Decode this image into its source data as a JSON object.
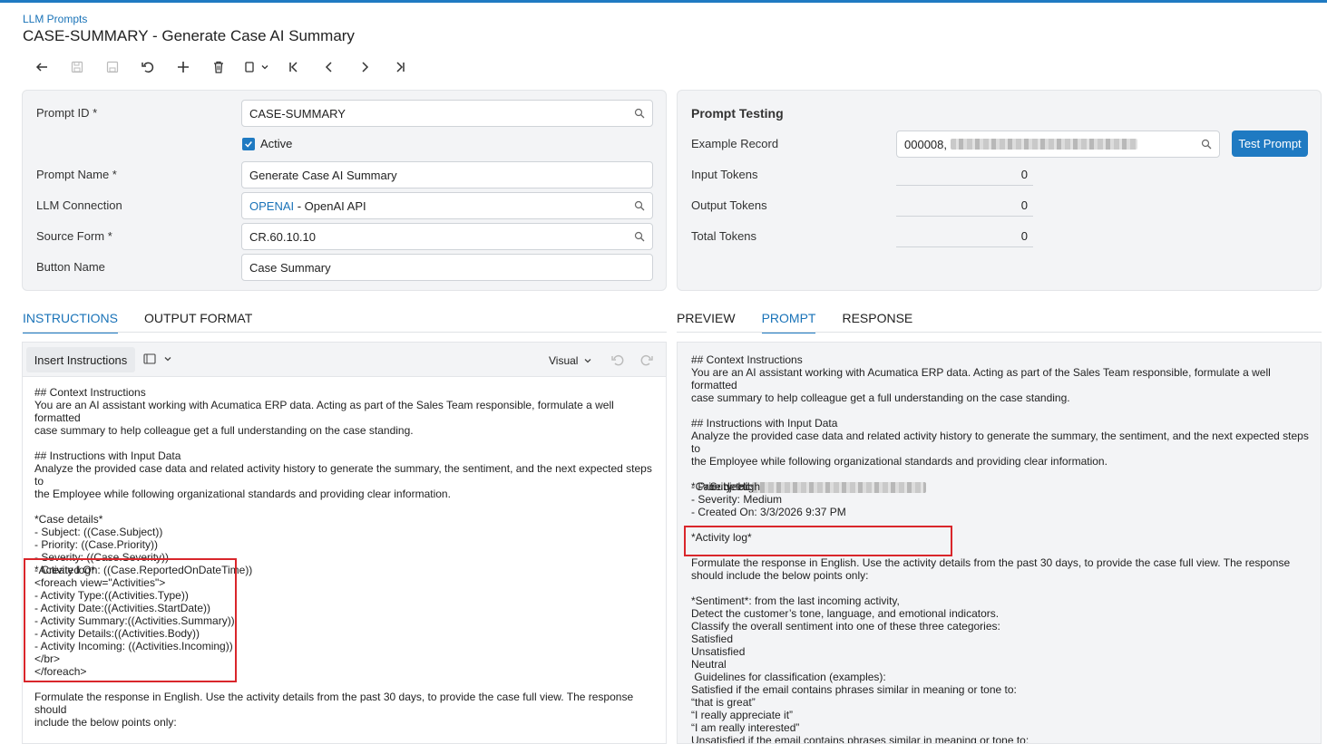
{
  "breadcrumb": "LLM Prompts",
  "title": "CASE-SUMMARY - Generate Case AI Summary",
  "toolbar": {
    "icons": [
      "back-icon",
      "save-close-icon",
      "save-icon",
      "undo-icon",
      "add-icon",
      "delete-icon",
      "copy-paste-icon",
      "first-icon",
      "previous-icon",
      "next-icon",
      "last-icon"
    ]
  },
  "form": {
    "prompt_id_label": "Prompt ID *",
    "prompt_id_value": "CASE-SUMMARY",
    "active_label": "Active",
    "active_checked": true,
    "prompt_name_label": "Prompt Name *",
    "prompt_name_value": "Generate Case AI Summary",
    "llm_connection_label": "LLM Connection",
    "llm_connection_link": "OPENAI",
    "llm_connection_rest": " - OpenAI API",
    "source_form_label": "Source Form *",
    "source_form_value": "CR.60.10.10",
    "button_name_label": "Button Name",
    "button_name_value": "Case Summary"
  },
  "testing": {
    "title": "Prompt Testing",
    "example_record_label": "Example Record",
    "example_record_value": "000008,",
    "test_button": "Test Prompt",
    "input_tokens_label": "Input Tokens",
    "input_tokens_value": "0",
    "output_tokens_label": "Output Tokens",
    "output_tokens_value": "0",
    "total_tokens_label": "Total Tokens",
    "total_tokens_value": "0"
  },
  "left_tabs": [
    "INSTRUCTIONS",
    "OUTPUT FORMAT"
  ],
  "right_tabs": [
    "PREVIEW",
    "PROMPT",
    "RESPONSE"
  ],
  "editor": {
    "insert_button": "Insert Instructions",
    "mode": "Visual",
    "text_part1": "## Context Instructions\nYou are an AI assistant working with Acumatica ERP data. Acting as part of the Sales Team responsible, formulate a well formatted\ncase summary to help colleague get a full understanding on the case standing.\n\n## Instructions with Input Data\nAnalyze the provided case data and related activity history to generate the summary, the sentiment, and the next expected steps to\nthe Employee while following organizational standards and providing clear information.\n\n*Case details*\n- Subject: ((Case.Subject))\n- Priority: ((Case.Priority))\n- Severity: ((Case.Severity))\n- Created On: ((Case.ReportedOnDateTime))",
    "text_part2": "*Activity log*\n<foreach view=\"Activities\">\n- Activity Type:((Activities.Type))\n- Activity Date:((Activities.StartDate))\n- Activity Summary:((Activities.Summary))\n- Activity Details:((Activities.Body))\n- Activity Incoming: ((Activities.Incoming))\n</br>\n</foreach>",
    "text_part3": "Formulate the response in English. Use the activity details from the past 30 days, to provide the case full view. The response should\ninclude the below points only:\n\n*Sentiment*: from the last incoming activity,"
  },
  "prompt_view": {
    "text_part1": "## Context Instructions\nYou are an AI assistant working with Acumatica ERP data. Acting as part of the Sales Team responsible, formulate a well formatted\ncase summary to help colleague get a full understanding on the case standing.\n\n## Instructions with Input Data\nAnalyze the provided case data and related activity history to generate the summary, the sentiment, and the next expected steps to\nthe Employee while following organizational standards and providing clear information.\n\n*Case details*",
    "subject_prefix": "- Subject: ",
    "text_part2": "- Priority: High\n- Severity: Medium\n- Created On: 3/3/2026 9:37 PM\n\n*Activity log*\n\nFormulate the response in English. Use the activity details from the past 30 days, to provide the case full view. The response\nshould include the below points only:\n\n*Sentiment*: from the last incoming activity,\nDetect the customer’s tone, language, and emotional indicators.\nClassify the overall sentiment into one of these three categories:\nSatisfied\nUnsatisfied\nNeutral\n Guidelines for classification (examples):\nSatisfied if the email contains phrases similar in meaning or tone to:\n“that is great”\n“I really appreciate it”\n“I am really interested”\nUnsatisfied if the email contains phrases similar in meaning or tone to:"
  }
}
